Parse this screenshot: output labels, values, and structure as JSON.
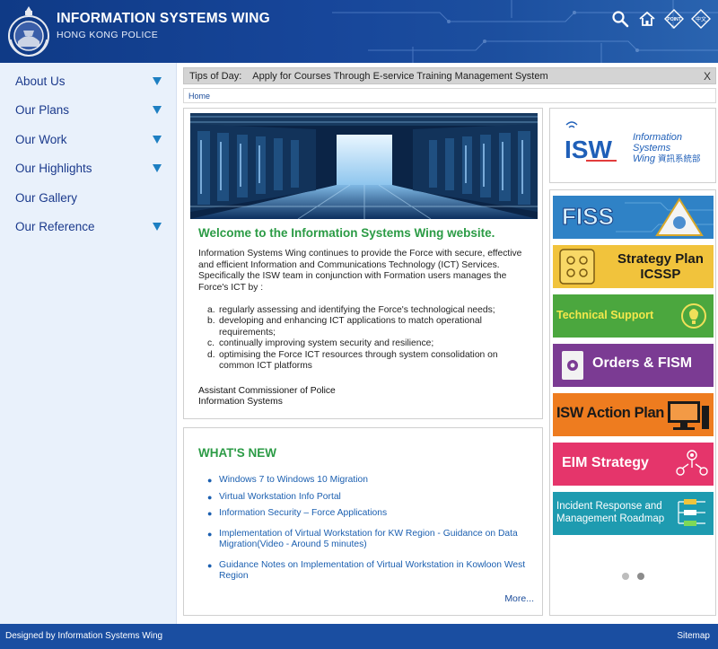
{
  "header": {
    "title": "INFORMATION SYSTEMS WING",
    "subtitle": "HONG KONG POLICE",
    "icons": [
      "search-icon",
      "home-icon",
      "point-icon",
      "chinese-language-icon"
    ],
    "point_label": "POINT",
    "lang_label": "中文"
  },
  "sidebar": {
    "items": [
      {
        "label": "About Us",
        "has_submenu": true
      },
      {
        "label": "Our Plans",
        "has_submenu": true
      },
      {
        "label": "Our Work",
        "has_submenu": true
      },
      {
        "label": "Our Highlights",
        "has_submenu": true
      },
      {
        "label": "Our Gallery",
        "has_submenu": false
      },
      {
        "label": "Our Reference",
        "has_submenu": true
      }
    ]
  },
  "tips": {
    "label": "Tips of Day:",
    "text": "Apply for Courses Through E-service Training Management System",
    "close": "X"
  },
  "breadcrumb": "Home",
  "welcome": {
    "title": "Welcome to the Information Systems Wing website.",
    "body": "Information Systems Wing continues to provide the Force with secure, effective and efficient Information and Communications Technology (ICT) Services. Specifically the ISW team in conjunction with Formation users manages the Force's ICT by :",
    "list": [
      {
        "key": "a.",
        "text": "regularly assessing and identifying the Force's technological needs;"
      },
      {
        "key": "b.",
        "text": "developing and enhancing ICT applications to match operational requirements;"
      },
      {
        "key": "c.",
        "text": "continually improving system security and resilience;"
      },
      {
        "key": "d.",
        "text": "optimising the Force ICT resources through system consolidation on common ICT platforms"
      }
    ],
    "sign_1": "Assistant Commissioner of Police",
    "sign_2": "Information Systems"
  },
  "news": {
    "title": "WHAT'S NEW",
    "items": [
      "Windows 7 to Windows 10 Migration",
      "Virtual Workstation Info Portal",
      "Information Security – Force Applications",
      "Implementation of Virtual Workstation for KW Region - Guidance on Data Migration(Video - Around 5 minutes)",
      "Guidance Notes on Implementation of Virtual Workstation in Kowloon West Region"
    ],
    "more": "More..."
  },
  "logo": {
    "letters": "ISW",
    "line1": "Information",
    "line2": "Systems",
    "line3": "Wing",
    "chinese": "資訊系統部"
  },
  "tiles": [
    {
      "label": "FISS",
      "color": "#2f82c6"
    },
    {
      "label_1": "Strategy Plan",
      "label_2": "ICSSP",
      "color": "#f1c33c"
    },
    {
      "label": "Technical Support",
      "color": "#4ba73e"
    },
    {
      "label": "Orders & FISM",
      "color": "#7b3b93"
    },
    {
      "label": "ISW Action Plan",
      "color": "#ee7c1f"
    },
    {
      "label": "EIM Strategy",
      "color": "#e5356b"
    },
    {
      "label_1": "Incident Response and",
      "label_2": "Management Roadmap",
      "color": "#1e9bb0"
    }
  ],
  "footer": {
    "left": "Designed by Information Systems Wing",
    "right": "Sitemap"
  }
}
